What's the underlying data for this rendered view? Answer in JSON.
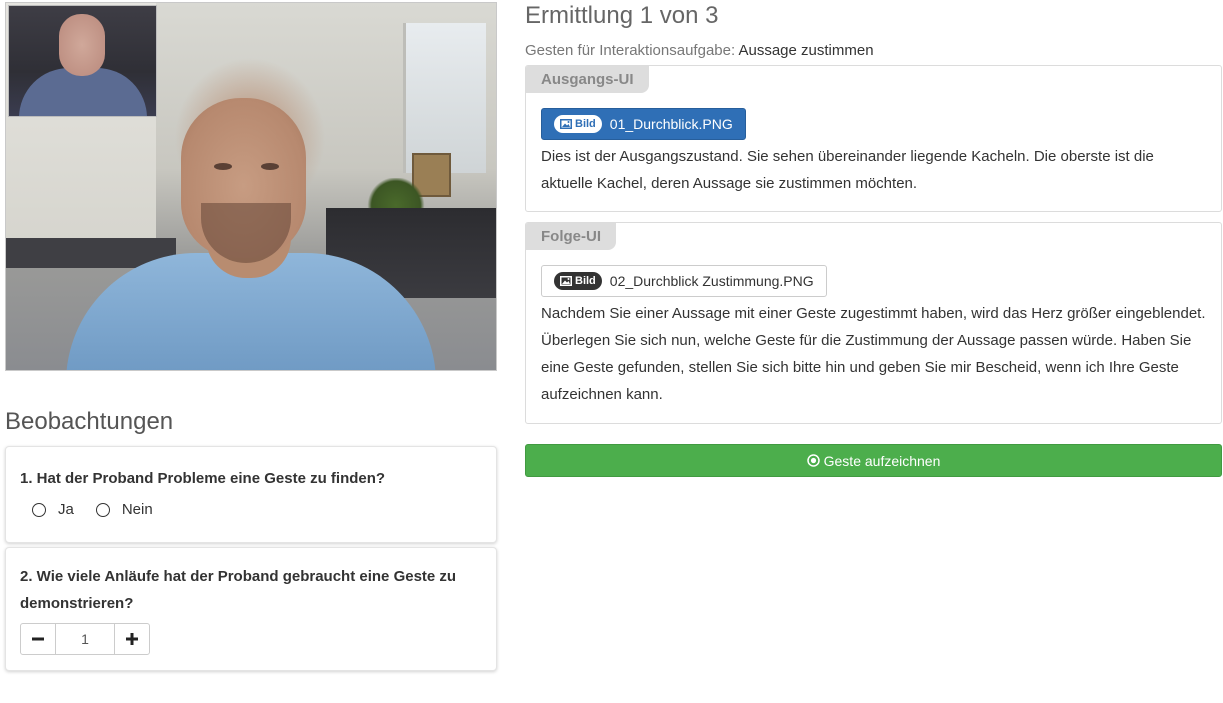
{
  "header": {
    "title": "Ermittlung 1 von 3",
    "subtitle_label": "Gesten für Interaktionsaufgabe:",
    "subtitle_value": "Aussage zustimmen"
  },
  "observations": {
    "title": "Beobachtungen",
    "q1": {
      "text": "1. Hat der Proband Probleme eine Geste zu finden?",
      "options": [
        "Ja",
        "Nein"
      ]
    },
    "q2": {
      "text": "2. Wie viele Anläufe hat der Proband gebraucht eine Geste zu demonstrieren?",
      "value": "1"
    }
  },
  "panels": {
    "initial": {
      "tag": "Ausgangs-UI",
      "badge": "Bild",
      "file": "01_Durchblick.PNG",
      "text": "Dies ist der Ausgangszustand. Sie sehen übereinander liegende Kacheln. Die oberste ist die aktuelle Kachel, deren Aussage sie zustimmen möchten."
    },
    "following": {
      "tag": "Folge-UI",
      "badge": "Bild",
      "file": "02_Durchblick Zustimmung.PNG",
      "text": "Nachdem Sie einer Aussage mit einer Geste zugestimmt haben, wird das Herz größer eingeblendet. Überlegen Sie sich nun, welche Geste für die Zustimmung der Aussage passen würde. Haben Sie eine Geste gefunden, stellen Sie sich bitte hin und geben Sie mir Bescheid, wenn ich Ihre Geste aufzeichnen kann."
    }
  },
  "record_button": "Geste aufzeichnen",
  "colors": {
    "primary": "#2f6fb6",
    "success": "#4cae4c",
    "tag_bg": "#dddddd"
  },
  "icons": {
    "image": "image-icon",
    "record": "record-circle-icon",
    "minus": "minus-icon",
    "plus": "plus-icon"
  }
}
